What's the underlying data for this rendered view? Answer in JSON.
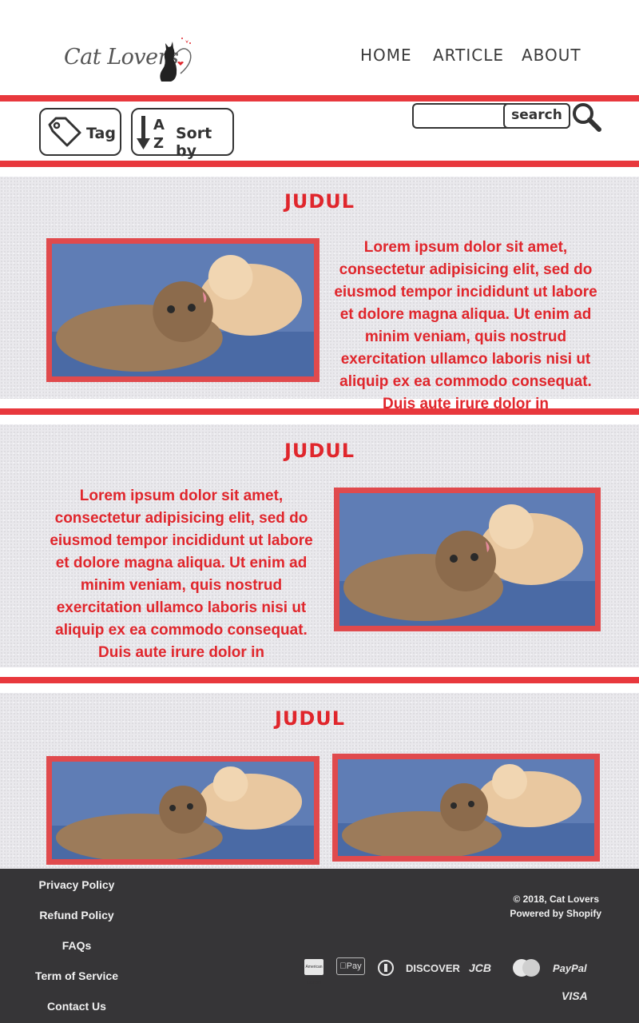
{
  "header": {
    "logo_text": "Cat Lovers",
    "nav": [
      "HOME",
      "ARTICLE",
      "ABOUT"
    ]
  },
  "toolbar": {
    "tag_label": "Tag",
    "sort_label": "Sort by",
    "sort_icon_text": "AZ",
    "search_value": "",
    "search_button": "search"
  },
  "sections": [
    {
      "title": "JUDUL",
      "text": "Lorem ipsum dolor sit amet, consectetur adipisicing elit, sed do eiusmod tempor incididunt ut labore et dolore magna aliqua. Ut enim ad minim veniam, quis nostrud exercitation ullamco laboris nisi ut aliquip ex ea commodo consequat. Duis aute irure dolor in"
    },
    {
      "title": "JUDUL",
      "text": "Lorem ipsum dolor sit amet, consectetur adipisicing elit, sed do eiusmod tempor incididunt ut labore et dolore magna aliqua. Ut enim ad minim veniam, quis nostrud exercitation ullamco laboris nisi ut aliquip ex ea commodo consequat. Duis aute irure dolor in"
    },
    {
      "title": "JUDUL"
    }
  ],
  "footer": {
    "links": [
      "Privacy Policy",
      "Refund Policy",
      "FAQs",
      "Term of Service",
      "Contact Us"
    ],
    "copyright": "© 2018, Cat Lovers",
    "powered": "Powered by Shopify",
    "payments": [
      "American Express",
      "Pay",
      "Diners Club",
      "DISCOVER",
      "JCB",
      "MasterCard",
      "PayPal",
      "VISA"
    ]
  },
  "colors": {
    "accent_red": "#e8383d",
    "text_red": "#e0262c",
    "footer_bg": "#363537",
    "section_bg": "#e9e8ec"
  }
}
